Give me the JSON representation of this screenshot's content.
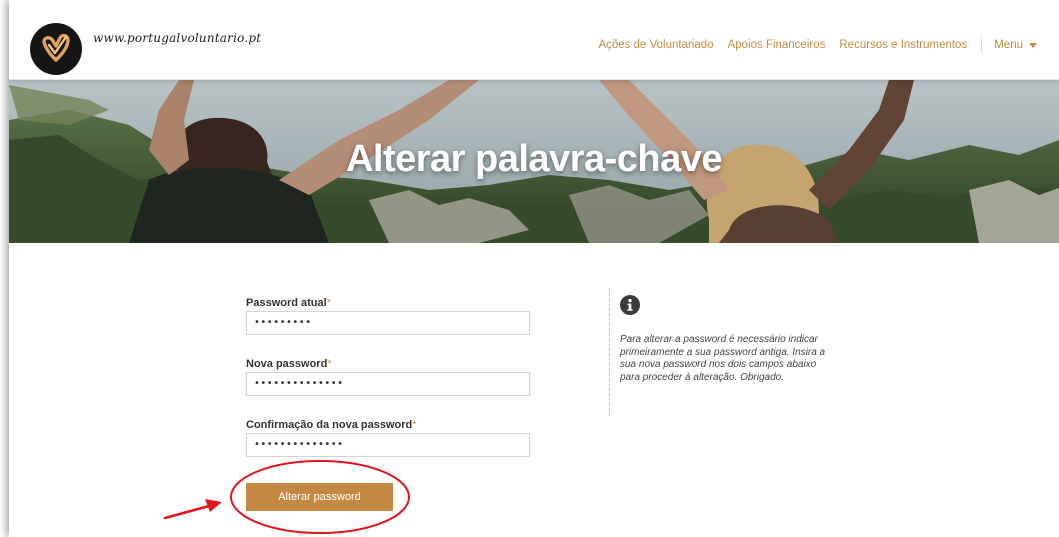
{
  "site": {
    "name": "www.portugalvoluntario.pt"
  },
  "nav": {
    "items": [
      {
        "label": "Ações de Voluntariado"
      },
      {
        "label": "Apoios Financeiros"
      },
      {
        "label": "Recursos e Instrumentos"
      }
    ],
    "menu_label": "Menu"
  },
  "banner": {
    "title": "Alterar palavra-chave"
  },
  "form": {
    "current": {
      "label": "Password atual",
      "required": "*",
      "value": "•••••••••"
    },
    "new": {
      "label": "Nova password",
      "required": "*",
      "value": "••••••••••••••"
    },
    "confirm": {
      "label": "Confirmação da nova password",
      "required": "*",
      "value": "••••••••••••••"
    },
    "submit_label": "Alterar password"
  },
  "info": {
    "text": "Para alterar a password é necessário indicar primeiramente a sua password antiga. Insira a sua nova password nos dois campos abaixo para proceder à alteração. Obrigado."
  },
  "colors": {
    "accent": "#c48a44",
    "annotation": "#e0161b"
  }
}
